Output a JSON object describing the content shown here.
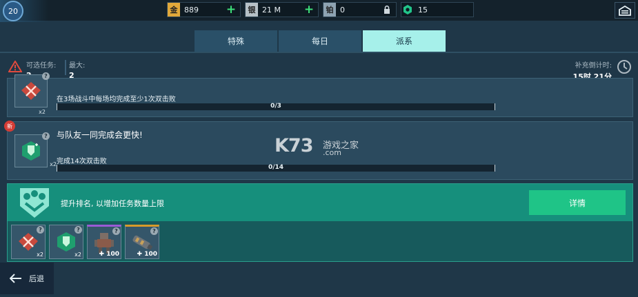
{
  "colors": {
    "accent": "#a6f0ea",
    "confirm_button": "#1fc487",
    "new_badge": "#d43c35",
    "plus": "#3ee07a"
  },
  "player": {
    "level": "20"
  },
  "currencies": [
    {
      "icon_label": "金",
      "icon": "gold-coin-icon",
      "value": "889",
      "action": "plus"
    },
    {
      "icon_label": "银",
      "icon": "silver-coin-icon",
      "value": "21 M",
      "action": "plus"
    },
    {
      "icon_label": "铂",
      "icon": "platinum-icon",
      "value": "0",
      "action": "lock"
    },
    {
      "icon_label": "",
      "icon": "key-icon",
      "value": "15",
      "action": "none"
    }
  ],
  "tabs": [
    {
      "label": "特殊",
      "active": false
    },
    {
      "label": "每日",
      "active": false
    },
    {
      "label": "派系",
      "active": true
    }
  ],
  "info": {
    "available_label": "可选任务:",
    "available_value": "2",
    "max_label": "最大:",
    "max_value": "2",
    "refill_label": "补充倒计时:",
    "refill_value": "15时 21分"
  },
  "quests": [
    {
      "title": "",
      "description": "在3场战斗中每场均完成至少1次双击败",
      "progress_text": "0/3",
      "progress": 0,
      "multiplier": "x2",
      "icon": "crossed-swords-icon"
    },
    {
      "title": "与队友一同完成会更快!",
      "description": "完成14次双击败",
      "progress_text": "0/14",
      "progress": 0,
      "multiplier": "x2",
      "icon": "shield-icon",
      "badge": "新"
    }
  ],
  "rank": {
    "text": "提升排名, 以增加任务数量上限",
    "button": "详情",
    "rewards": [
      {
        "icon": "crossed-swords-icon",
        "label": "x2"
      },
      {
        "icon": "shield-icon",
        "label": "x2"
      },
      {
        "icon": "robot-icon",
        "label": "100"
      },
      {
        "icon": "weapon-icon",
        "label": "100"
      }
    ]
  },
  "footer": {
    "back_label": "后退"
  },
  "watermark": {
    "logo": "K73",
    "name": "游戏之家",
    "domain": ".com"
  }
}
